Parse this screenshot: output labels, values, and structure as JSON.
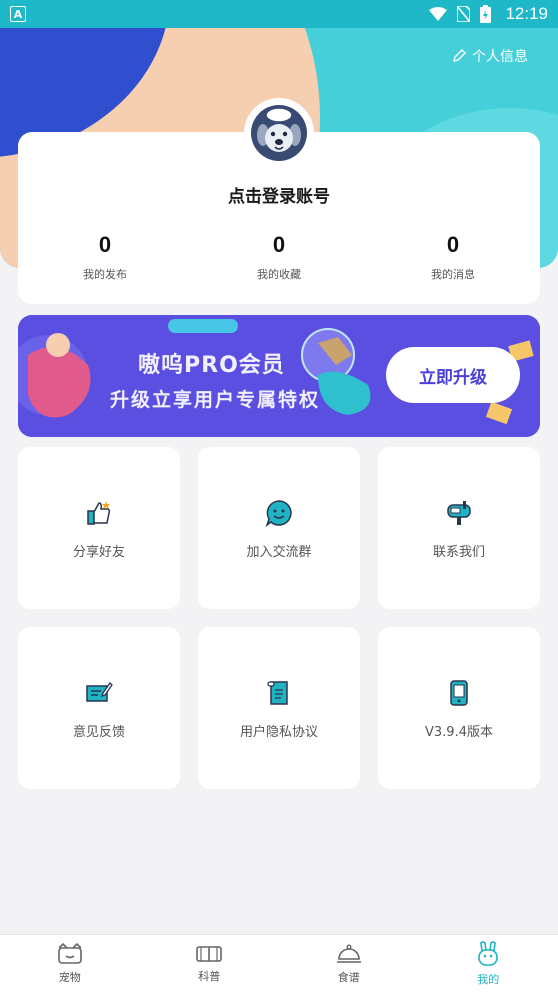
{
  "status_bar": {
    "time": "12:19"
  },
  "header": {
    "profile_link": "个人信息"
  },
  "profile": {
    "login_prompt": "点击登录账号",
    "stats": [
      {
        "value": "0",
        "label": "我的发布"
      },
      {
        "value": "0",
        "label": "我的收藏"
      },
      {
        "value": "0",
        "label": "我的消息"
      }
    ]
  },
  "banner": {
    "title": "嗷呜PRO会员",
    "subtitle": "升级立享用户专属特权",
    "button": "立即升级"
  },
  "menu": [
    {
      "label": "分享好友",
      "icon": "thumbs-up-icon"
    },
    {
      "label": "加入交流群",
      "icon": "chat-smile-icon"
    },
    {
      "label": "联系我们",
      "icon": "mailbox-icon"
    },
    {
      "label": "意见反馈",
      "icon": "feedback-icon"
    },
    {
      "label": "用户隐私协议",
      "icon": "scroll-icon"
    },
    {
      "label": "V3.9.4版本",
      "icon": "phone-icon"
    }
  ],
  "bottom_nav": [
    {
      "label": "宠物",
      "icon": "pet-icon"
    },
    {
      "label": "科普",
      "icon": "book-icon"
    },
    {
      "label": "食谱",
      "icon": "cloche-icon"
    },
    {
      "label": "我的",
      "icon": "bunny-icon"
    }
  ],
  "colors": {
    "accent": "#1fb3c4",
    "header": "#45cfd9",
    "banner": "#5a4fe0"
  }
}
